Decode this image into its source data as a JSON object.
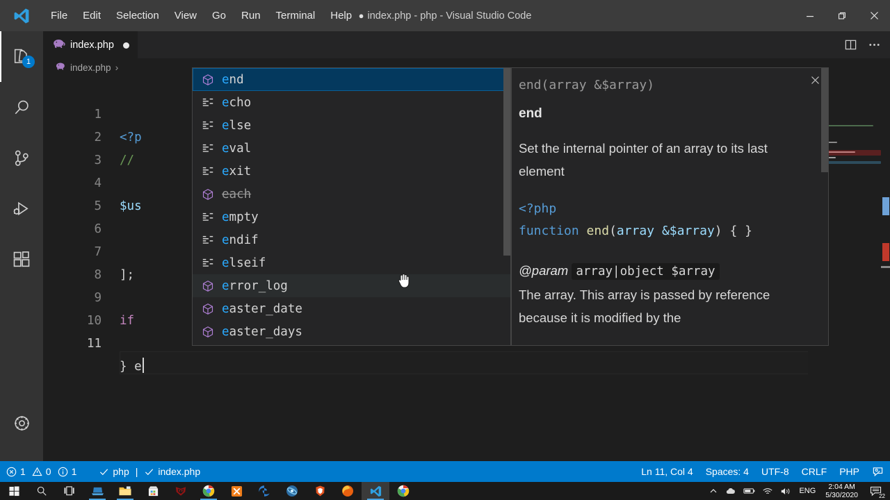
{
  "window": {
    "title": "index.php - php - Visual Studio Code",
    "dirty_indicator": "●",
    "minimize_icon": "minimize-icon",
    "restore_icon": "restore-icon",
    "close_icon": "close-icon"
  },
  "menubar": {
    "items": [
      {
        "label": "File"
      },
      {
        "label": "Edit"
      },
      {
        "label": "Selection"
      },
      {
        "label": "View"
      },
      {
        "label": "Go"
      },
      {
        "label": "Run"
      },
      {
        "label": "Terminal"
      },
      {
        "label": "Help"
      }
    ]
  },
  "activitybar": {
    "items": [
      {
        "name": "explorer",
        "icon": "files-icon",
        "badge": "1",
        "active": true
      },
      {
        "name": "search",
        "icon": "search-icon",
        "badge": "",
        "active": false
      },
      {
        "name": "source-control",
        "icon": "source-control-icon",
        "badge": "",
        "active": false
      },
      {
        "name": "run-debug",
        "icon": "run-and-debug-icon",
        "badge": "",
        "active": false
      },
      {
        "name": "extensions",
        "icon": "extensions-icon",
        "badge": "",
        "active": false
      }
    ],
    "manage": {
      "name": "settings",
      "icon": "gear-icon"
    }
  },
  "tabs": [
    {
      "label": "index.php",
      "icon": "php-elephant-icon",
      "dirty": true,
      "active": true
    }
  ],
  "tab_actions": [
    {
      "name": "split-editor",
      "icon": "split-editor-icon"
    },
    {
      "name": "more-actions",
      "icon": "ellipsis-icon"
    }
  ],
  "breadcrumbs": {
    "items": [
      {
        "label": "index.php",
        "icon": "php-elephant-icon"
      }
    ],
    "separator": "›"
  },
  "editor": {
    "lines": [
      {
        "num": "1",
        "text": "<?p"
      },
      {
        "num": "2",
        "text": "//"
      },
      {
        "num": "3",
        "text": ""
      },
      {
        "num": "4",
        "text": "$us"
      },
      {
        "num": "5",
        "text": ""
      },
      {
        "num": "6",
        "text": ""
      },
      {
        "num": "7",
        "text": "];"
      },
      {
        "num": "8",
        "text": ""
      },
      {
        "num": "9",
        "text": "if"
      },
      {
        "num": "10",
        "text": ""
      },
      {
        "num": "11",
        "text": "} e"
      }
    ],
    "cursor_line": "11"
  },
  "suggest": {
    "items": [
      {
        "label": "end",
        "match": "e",
        "icon": "method-cube-icon",
        "selected": true,
        "hovered": false,
        "deprecated": false
      },
      {
        "label": "echo",
        "match": "e",
        "icon": "keyword-lines-icon",
        "selected": false,
        "hovered": false,
        "deprecated": false
      },
      {
        "label": "else",
        "match": "e",
        "icon": "keyword-lines-icon",
        "selected": false,
        "hovered": false,
        "deprecated": false
      },
      {
        "label": "eval",
        "match": "e",
        "icon": "keyword-lines-icon",
        "selected": false,
        "hovered": false,
        "deprecated": false
      },
      {
        "label": "exit",
        "match": "e",
        "icon": "keyword-lines-icon",
        "selected": false,
        "hovered": false,
        "deprecated": false
      },
      {
        "label": "each",
        "match": "e",
        "icon": "method-cube-icon",
        "selected": false,
        "hovered": false,
        "deprecated": true
      },
      {
        "label": "empty",
        "match": "e",
        "icon": "keyword-lines-icon",
        "selected": false,
        "hovered": false,
        "deprecated": false
      },
      {
        "label": "endif",
        "match": "e",
        "icon": "keyword-lines-icon",
        "selected": false,
        "hovered": false,
        "deprecated": false
      },
      {
        "label": "elseif",
        "match": "e",
        "icon": "keyword-lines-icon",
        "selected": false,
        "hovered": false,
        "deprecated": false
      },
      {
        "label": "error_log",
        "match": "e",
        "icon": "method-cube-icon",
        "selected": false,
        "hovered": true,
        "deprecated": false
      },
      {
        "label": "easter_date",
        "match": "e",
        "icon": "method-cube-icon",
        "selected": false,
        "hovered": false,
        "deprecated": false
      },
      {
        "label": "easter_days",
        "match": "e",
        "icon": "method-cube-icon",
        "selected": false,
        "hovered": false,
        "deprecated": false
      }
    ]
  },
  "doc": {
    "close_icon": "close-icon",
    "signature": "end(array &$array)",
    "title": "end",
    "description": "Set the internal pointer of an array to its last element",
    "code": {
      "open_tag": "<?php",
      "kw_function": "function",
      "fn_name": "end",
      "paren_open": "(",
      "type": "array",
      "param": "&$array",
      "paren_close": ")",
      "braces": " { }"
    },
    "param_tag": "@param",
    "param_signature": "array|object $array",
    "param_description": "The array. This array is passed by reference because it is modified by the"
  },
  "statusbar": {
    "left": [
      {
        "name": "problems",
        "errors_icon": "error-circle-icon",
        "errors": "1",
        "warnings_icon": "warning-triangle-icon",
        "warnings": "0",
        "info_icon": "info-circle-icon",
        "info": "1"
      },
      {
        "name": "php-check",
        "label": "php",
        "icon": "check-icon"
      },
      {
        "name": "file-check",
        "label": "index.php",
        "icon": "check-icon"
      }
    ],
    "separator": "|",
    "right": [
      {
        "name": "cursor-position",
        "label": "Ln 11, Col 4"
      },
      {
        "name": "indentation",
        "label": "Spaces: 4"
      },
      {
        "name": "encoding",
        "label": "UTF-8"
      },
      {
        "name": "eol",
        "label": "CRLF"
      },
      {
        "name": "language-mode",
        "label": "PHP"
      },
      {
        "name": "feedback",
        "label": "",
        "icon": "feedback-smiley-icon"
      }
    ],
    "accent_color": "#007acc"
  },
  "taskbar": {
    "items": [
      {
        "name": "start-button",
        "icon": "windows-logo-icon"
      },
      {
        "name": "search-button",
        "icon": "search-icon"
      },
      {
        "name": "task-view-button",
        "icon": "task-view-icon"
      },
      {
        "name": "file-explorer-blue",
        "icon": "laptop-icon",
        "running": true
      },
      {
        "name": "file-explorer",
        "icon": "folder-icon",
        "running": true
      },
      {
        "name": "microsoft-store",
        "icon": "store-icon"
      },
      {
        "name": "predator-sense",
        "icon": "predator-icon"
      },
      {
        "name": "chrome",
        "icon": "chrome-icon",
        "running": true
      },
      {
        "name": "xampp",
        "icon": "xampp-icon"
      },
      {
        "name": "edge",
        "icon": "edge-icon"
      },
      {
        "name": "atom",
        "icon": "atom-icon"
      },
      {
        "name": "brave",
        "icon": "brave-icon"
      },
      {
        "name": "firefox",
        "icon": "firefox-icon"
      },
      {
        "name": "vscode",
        "icon": "vscode-icon",
        "active": true,
        "running": true
      },
      {
        "name": "chrome-2",
        "icon": "chrome-icon"
      }
    ],
    "tray": {
      "chevron": "show-hidden-icons",
      "icons": [
        "onedrive-icon",
        "battery-icon",
        "wifi-icon",
        "volume-icon"
      ],
      "language": "ENG",
      "time": "2:04 AM",
      "date": "5/30/2020",
      "notification_count": "22"
    }
  }
}
